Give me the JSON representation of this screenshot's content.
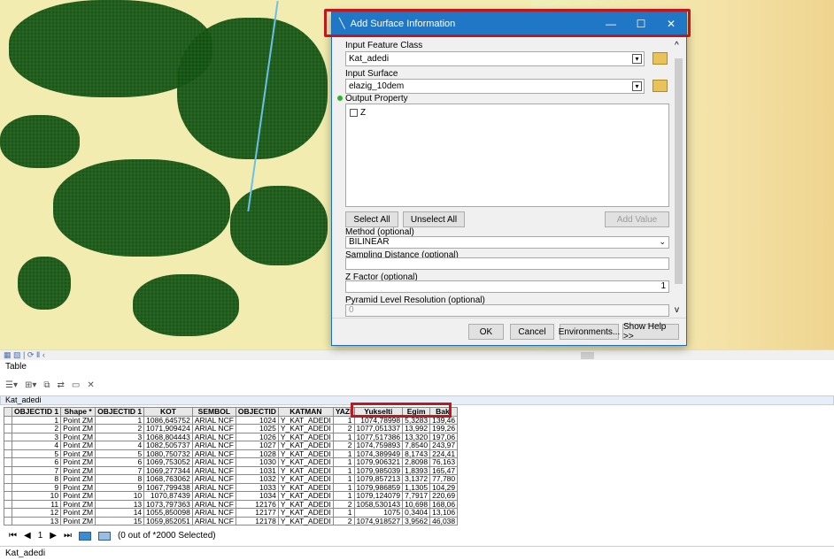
{
  "dialog": {
    "title": "Add Surface Information",
    "controls": {
      "minimize": "—",
      "maximize": "☐",
      "close": "✕"
    },
    "input_feature_class_label": "Input Feature Class",
    "input_feature_class_value": "Kat_adedi",
    "input_surface_label": "Input Surface",
    "input_surface_value": "elazig_10dem",
    "output_property_label": "Output Property",
    "output_property_option": "Z",
    "select_all": "Select All",
    "unselect_all": "Unselect All",
    "add_value": "Add Value",
    "method_label": "Method (optional)",
    "method_value": "BILINEAR",
    "sampling_label": "Sampling Distance (optional)",
    "zfactor_label": "Z Factor (optional)",
    "zfactor_value": "1",
    "pyramid_label": "Pyramid Level Resolution (optional)",
    "pyramid_value": "0",
    "ok": "OK",
    "cancel": "Cancel",
    "environments": "Environments...",
    "show_help": "Show Help >>"
  },
  "table": {
    "panel_title": "Table",
    "tab_name": "Kat_adedi",
    "columns": [
      "OBJECTID 1",
      "Shape *",
      "OBJECTID 1",
      "KOT",
      "SEMBOL",
      "OBJECTID",
      "KATMAN",
      "YAZI",
      "Yukselti",
      "Egim",
      "Baki"
    ],
    "rows": [
      [
        "1",
        "Point ZM",
        "1",
        "1086,645752",
        "ARIAL NCF",
        "1024",
        "Y_KAT_ADEDI",
        "1",
        "1074,78998",
        "5,3283",
        "139,46"
      ],
      [
        "2",
        "Point ZM",
        "2",
        "1071,909424",
        "ARIAL NCF",
        "1025",
        "Y_KAT_ADEDI",
        "2",
        "1077,051337",
        "13,992",
        "199,26"
      ],
      [
        "3",
        "Point ZM",
        "3",
        "1068,804443",
        "ARIAL NCF",
        "1026",
        "Y_KAT_ADEDI",
        "1",
        "1077,517386",
        "13,320",
        "197,06"
      ],
      [
        "4",
        "Point ZM",
        "4",
        "1082,505737",
        "ARIAL NCF",
        "1027",
        "Y_KAT_ADEDI",
        "2",
        "1074,759893",
        "7,8540",
        "243,97"
      ],
      [
        "5",
        "Point ZM",
        "5",
        "1080,750732",
        "ARIAL NCF",
        "1028",
        "Y_KAT_ADEDI",
        "1",
        "1074,389949",
        "8,1743",
        "224,41"
      ],
      [
        "6",
        "Point ZM",
        "6",
        "1069,753052",
        "ARIAL NCF",
        "1030",
        "Y_KAT_ADEDI",
        "1",
        "1079,906321",
        "2,8098",
        "76,163"
      ],
      [
        "7",
        "Point ZM",
        "7",
        "1069,277344",
        "ARIAL NCF",
        "1031",
        "Y_KAT_ADEDI",
        "1",
        "1079,985039",
        "1,8393",
        "165,47"
      ],
      [
        "8",
        "Point ZM",
        "8",
        "1068,763062",
        "ARIAL NCF",
        "1032",
        "Y_KAT_ADEDI",
        "1",
        "1079,857213",
        "3,1372",
        "77,780"
      ],
      [
        "9",
        "Point ZM",
        "9",
        "1067,799438",
        "ARIAL NCF",
        "1033",
        "Y_KAT_ADEDI",
        "1",
        "1079,986859",
        "1,1305",
        "104,29"
      ],
      [
        "10",
        "Point ZM",
        "10",
        "1070,87439",
        "ARIAL NCF",
        "1034",
        "Y_KAT_ADEDI",
        "1",
        "1079,124079",
        "7,7917",
        "220,69"
      ],
      [
        "11",
        "Point ZM",
        "13",
        "1073,797363",
        "ARIAL NCF",
        "12176",
        "Y_KAT_ADEDI",
        "2",
        "1058,530143",
        "10,698",
        "168,06"
      ],
      [
        "12",
        "Point ZM",
        "14",
        "1055,850098",
        "ARIAL NCF",
        "12177",
        "Y_KAT_ADEDI",
        "1",
        "1075",
        "0,3404",
        "13,106"
      ],
      [
        "13",
        "Point ZM",
        "15",
        "1059,852051",
        "ARIAL NCF",
        "12178",
        "Y_KAT_ADEDI",
        "2",
        "1074,918527",
        "3,9562",
        "46,038"
      ]
    ],
    "record_nav": "1",
    "selection_status": "(0 out of *2000 Selected)"
  },
  "bottom_tab": "Kat_adedi"
}
